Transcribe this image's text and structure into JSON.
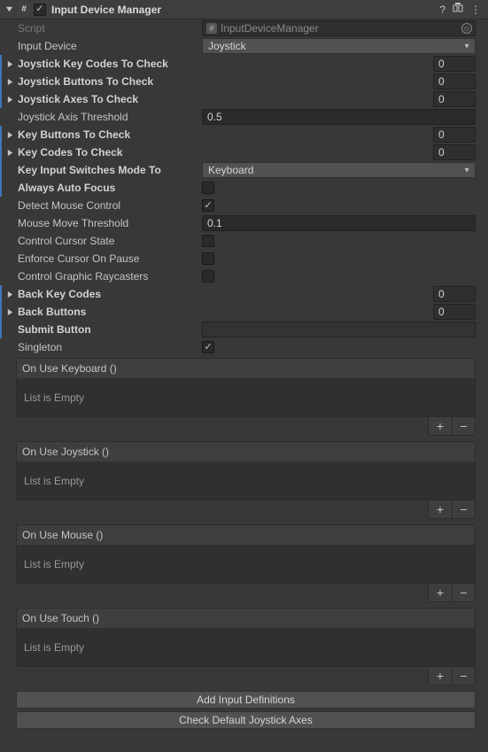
{
  "header": {
    "title": "Input Device Manager",
    "enabled": true
  },
  "fields": {
    "script_label": "Script",
    "script_value": "InputDeviceManager",
    "input_device_label": "Input Device",
    "input_device_value": "Joystick",
    "joystick_key_codes_label": "Joystick Key Codes To Check",
    "joystick_key_codes_value": "0",
    "joystick_buttons_label": "Joystick Buttons To Check",
    "joystick_buttons_value": "0",
    "joystick_axes_label": "Joystick Axes To Check",
    "joystick_axes_value": "0",
    "joystick_axis_threshold_label": "Joystick Axis Threshold",
    "joystick_axis_threshold_value": "0.5",
    "key_buttons_label": "Key Buttons To Check",
    "key_buttons_value": "0",
    "key_codes_label": "Key Codes To Check",
    "key_codes_value": "0",
    "key_input_switches_label": "Key Input Switches Mode To",
    "key_input_switches_value": "Keyboard",
    "always_auto_focus_label": "Always Auto Focus",
    "always_auto_focus_value": false,
    "detect_mouse_label": "Detect Mouse Control",
    "detect_mouse_value": true,
    "mouse_move_threshold_label": "Mouse Move Threshold",
    "mouse_move_threshold_value": "0.1",
    "control_cursor_state_label": "Control Cursor State",
    "control_cursor_state_value": false,
    "enforce_cursor_pause_label": "Enforce Cursor On Pause",
    "enforce_cursor_pause_value": false,
    "control_graphic_raycasters_label": "Control Graphic Raycasters",
    "control_graphic_raycasters_value": false,
    "back_key_codes_label": "Back Key Codes",
    "back_key_codes_value": "0",
    "back_buttons_label": "Back Buttons",
    "back_buttons_value": "0",
    "submit_button_label": "Submit Button",
    "submit_button_value": "",
    "singleton_label": "Singleton",
    "singleton_value": true
  },
  "events": {
    "keyboard_title": "On Use Keyboard ()",
    "joystick_title": "On Use Joystick ()",
    "mouse_title": "On Use Mouse ()",
    "touch_title": "On Use Touch ()",
    "empty_text": "List is Empty"
  },
  "buttons": {
    "add_input_definitions": "Add Input Definitions",
    "check_default_joystick_axes": "Check Default Joystick Axes"
  }
}
